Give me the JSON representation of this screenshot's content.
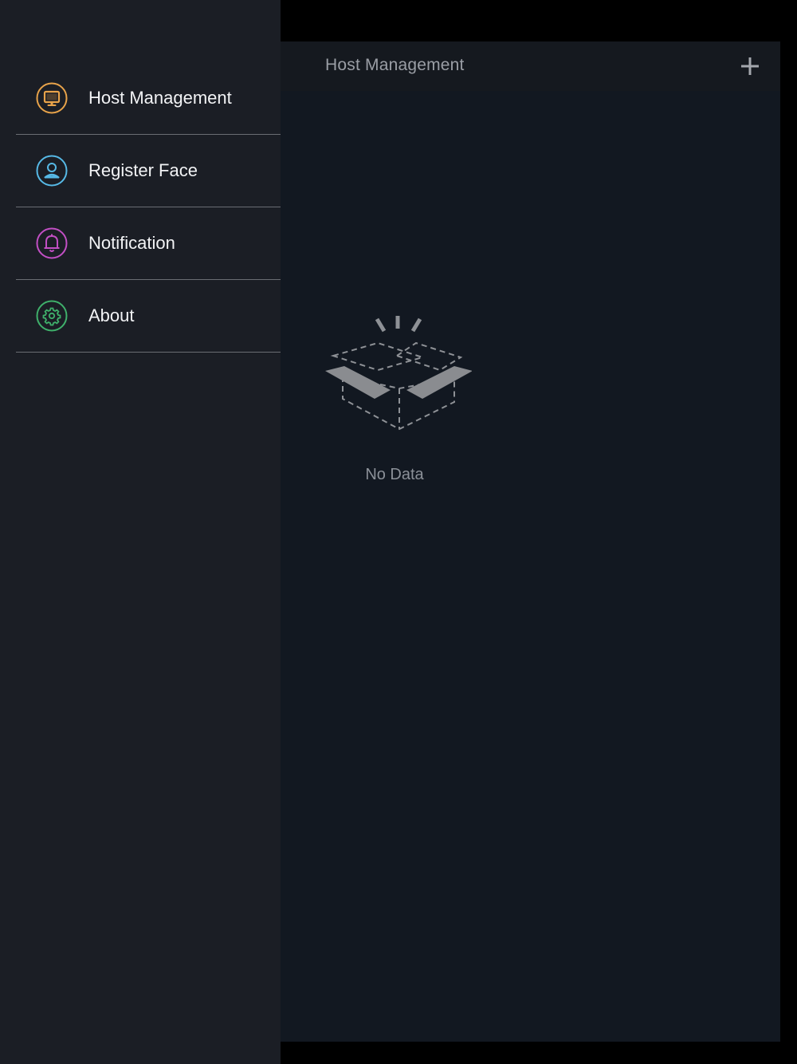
{
  "main": {
    "title": "Host Management",
    "add_icon": "plus-icon",
    "empty_icon": "empty-box-icon",
    "empty_text": "No Data"
  },
  "drawer": {
    "items": [
      {
        "label": "Host Management",
        "icon": "monitor-icon",
        "color": "#e8a34a"
      },
      {
        "label": "Register Face",
        "icon": "user-icon",
        "color": "#56b9e6"
      },
      {
        "label": "Notification",
        "icon": "bell-icon",
        "color": "#c24fc4"
      },
      {
        "label": "About",
        "icon": "gear-icon",
        "color": "#3fb06b"
      }
    ]
  },
  "colors": {
    "drawer_bg": "#1b1e25",
    "main_bg": "#121821",
    "header_bg": "#15191f",
    "divider": "#6a6d73"
  }
}
